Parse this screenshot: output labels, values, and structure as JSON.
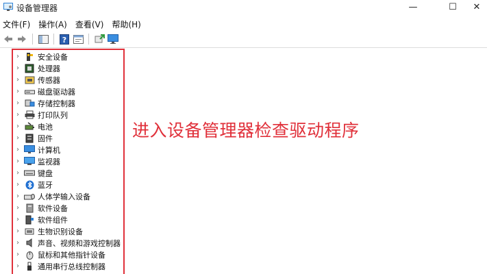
{
  "window": {
    "title": "设备管理器",
    "min_glyph": "—",
    "max_glyph": "☐",
    "close_glyph": "✕"
  },
  "menu": [
    "文件(F)",
    "操作(A)",
    "查看(V)",
    "帮助(H)"
  ],
  "toolbar": {
    "icons": [
      "back-arrow-icon",
      "forward-arrow-icon",
      "show-hide-tree-icon",
      "help-icon",
      "properties-icon",
      "update-driver-icon",
      "monitor-scan-icon"
    ]
  },
  "tree": {
    "items": [
      {
        "label": "安全设备",
        "icon": "security-key-icon"
      },
      {
        "label": "处理器",
        "icon": "processor-icon"
      },
      {
        "label": "传感器",
        "icon": "sensor-icon"
      },
      {
        "label": "磁盘驱动器",
        "icon": "disk-drive-icon"
      },
      {
        "label": "存储控制器",
        "icon": "storage-controller-icon"
      },
      {
        "label": "打印队列",
        "icon": "printer-icon"
      },
      {
        "label": "电池",
        "icon": "battery-icon"
      },
      {
        "label": "固件",
        "icon": "firmware-icon"
      },
      {
        "label": "计算机",
        "icon": "computer-icon"
      },
      {
        "label": "监视器",
        "icon": "monitor-icon"
      },
      {
        "label": "键盘",
        "icon": "keyboard-icon"
      },
      {
        "label": "蓝牙",
        "icon": "bluetooth-icon"
      },
      {
        "label": "人体学输入设备",
        "icon": "hid-icon"
      },
      {
        "label": "软件设备",
        "icon": "software-device-icon"
      },
      {
        "label": "软件组件",
        "icon": "software-component-icon"
      },
      {
        "label": "生物识别设备",
        "icon": "biometric-icon"
      },
      {
        "label": "声音、视频和游戏控制器",
        "icon": "speaker-icon"
      },
      {
        "label": "鼠标和其他指针设备",
        "icon": "mouse-icon"
      },
      {
        "label": "通用串行总线控制器",
        "icon": "usb-icon"
      }
    ]
  },
  "annotation": "进入设备管理器检查驱动程序",
  "colors": {
    "annotation_red": "#e0303a",
    "icon_blue": "#2b7fd4",
    "icon_dark": "#3a3a3a"
  }
}
